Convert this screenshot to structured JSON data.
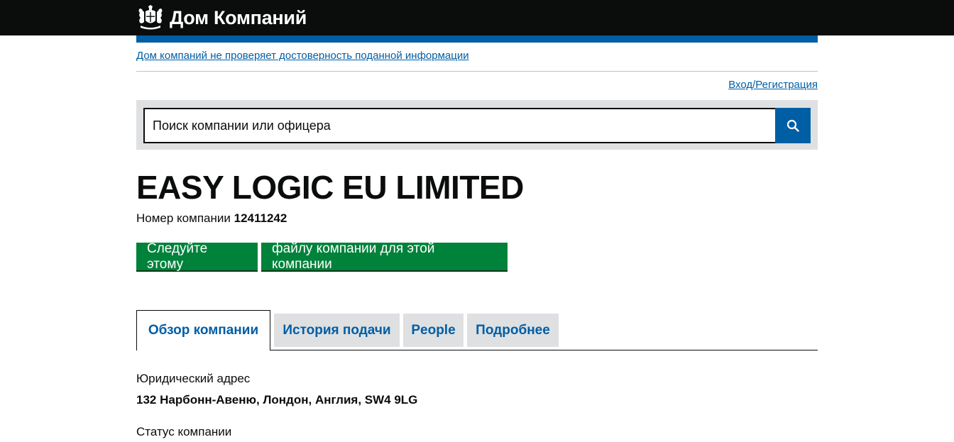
{
  "header": {
    "brand_name": "Дом Компаний",
    "crest_icon": "royal-crest-icon"
  },
  "notice": {
    "disclaimer_link": "Дом компаний не проверяет достоверность поданной информации",
    "login_link": "Вход/Регистрация"
  },
  "search": {
    "placeholder": "Поиск компании или офицера",
    "button_icon": "search-icon"
  },
  "company": {
    "name": "EASY LOGIC EU LIMITED",
    "number_label": "Номер компании",
    "number": "12411242"
  },
  "actions": {
    "follow_label": "Следуйте этому",
    "file_label": "файлу компании для этой компании"
  },
  "tabs": [
    {
      "label": "Обзор компании",
      "active": true
    },
    {
      "label": "История подачи",
      "active": false
    },
    {
      "label": "People",
      "active": false
    },
    {
      "label": "Подробнее",
      "active": false
    }
  ],
  "overview": {
    "registered_address_label": "Юридический адрес",
    "registered_address": "132 Нарбонн-Авеню, Лондон, Англия, SW4 9LG",
    "status_label": "Статус компании"
  },
  "colors": {
    "header_bg": "#0b0c0c",
    "link_blue": "#005ea5",
    "button_green": "#00823b",
    "panel_grey": "#dee0e2"
  }
}
